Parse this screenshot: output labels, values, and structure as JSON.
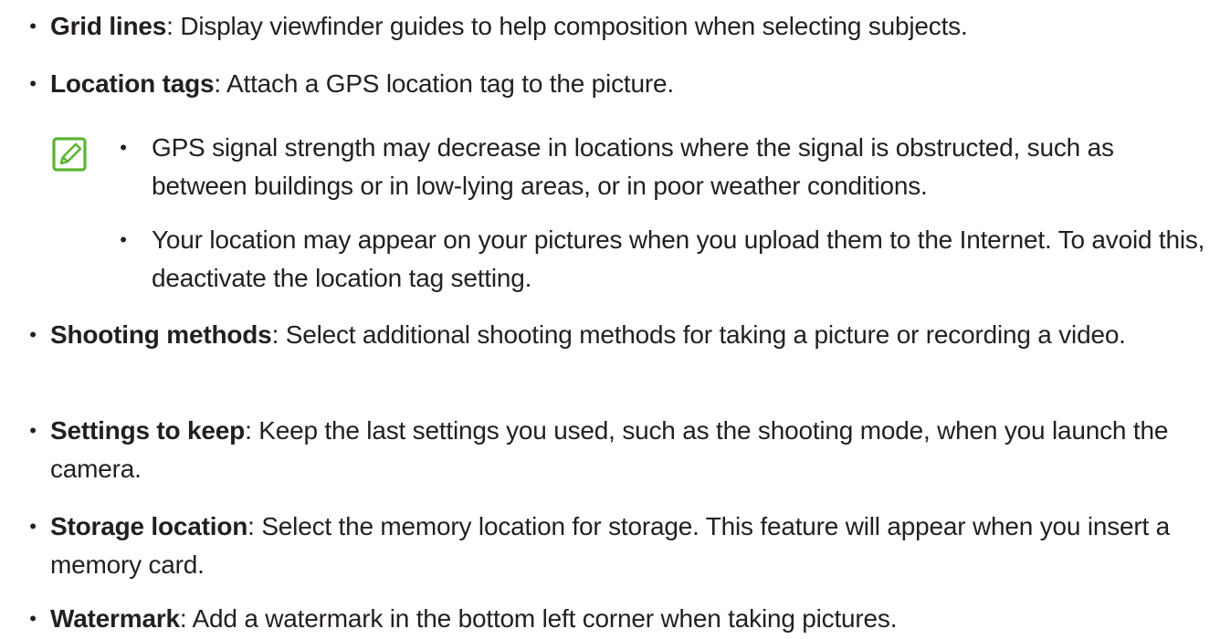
{
  "items": [
    {
      "term": "Grid lines",
      "description": ": Display viewfinder guides to help composition when selecting subjects."
    },
    {
      "term": "Location tags",
      "description": ": Attach a GPS location tag to the picture."
    },
    {
      "term": "Shooting methods",
      "description": ": Select additional shooting methods for taking a picture or recording a video."
    },
    {
      "term": "Settings to keep",
      "description": ": Keep the last settings you used, such as the shooting mode, when you launch the camera."
    },
    {
      "term": "Storage location",
      "description": ": Select the memory location for storage. This feature will appear when you insert a memory card."
    },
    {
      "term": "Watermark",
      "description": ": Add a watermark in the bottom left corner when taking pictures."
    }
  ],
  "note": {
    "icon": "note-icon",
    "icon_color": "#5cb531",
    "items": [
      "GPS signal strength may decrease in locations where the signal is obstructed, such as between buildings or in low-lying areas, or in poor weather conditions.",
      "Your location may appear on your pictures when you upload them to the Internet. To avoid this, deactivate the location tag setting."
    ]
  },
  "bullet_char": "•"
}
